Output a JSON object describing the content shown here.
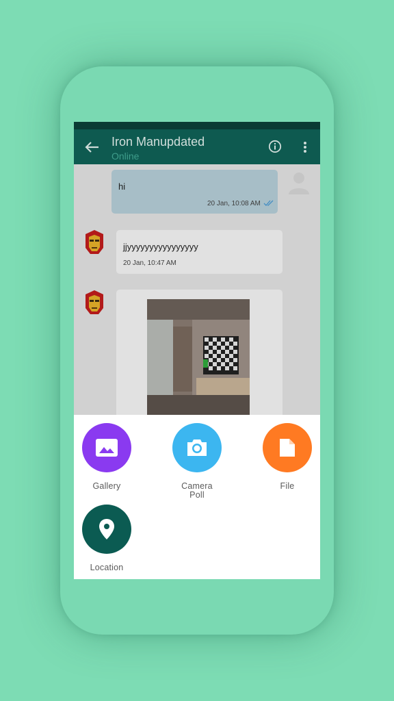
{
  "chat_header": {
    "title": "Iron Manupdated",
    "status": "Online"
  },
  "messages": [
    {
      "text": "hi",
      "time": "20 Jan, 10:08 AM",
      "direction": "outgoing"
    },
    {
      "text": "jjyyyyyyyyyyyyyyyy",
      "time": "20 Jan, 10:47 AM",
      "direction": "incoming"
    },
    {
      "type": "image",
      "direction": "incoming"
    }
  ],
  "attach_options": [
    {
      "label": "Gallery",
      "color": "#8a3af0",
      "icon": "image-icon"
    },
    {
      "label": "Camera",
      "overlay_label": "Poll",
      "color": "#3cb6f0",
      "icon": "camera-icon"
    },
    {
      "label": "File",
      "color": "#ff7a22",
      "icon": "file-icon"
    },
    {
      "label": "Location",
      "color": "#0b5b52",
      "icon": "location-icon"
    }
  ],
  "colors": {
    "background": "#7ddcb4",
    "appbar": "#0e5a50",
    "statusbar": "#0a3b34"
  }
}
